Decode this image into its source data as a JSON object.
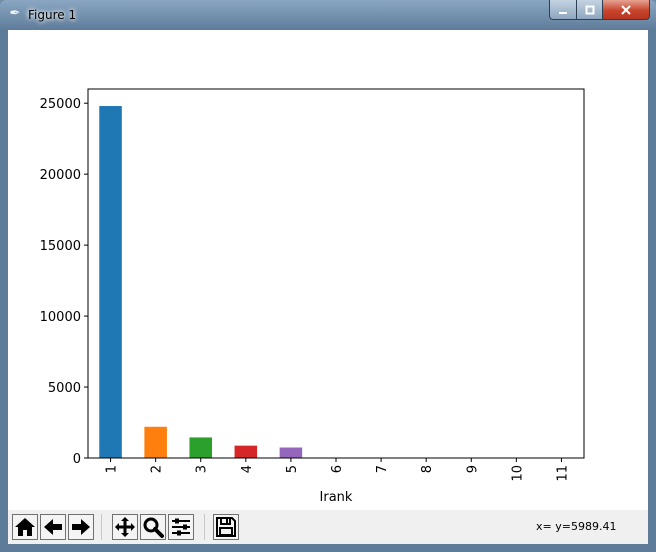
{
  "window": {
    "title": "Figure 1",
    "icon": "feather-icon",
    "buttons": [
      "minimize-icon",
      "maximize-icon",
      "close-icon"
    ]
  },
  "toolbar": {
    "buttons": [
      "home-icon",
      "back-arrow-icon",
      "forward-arrow-icon",
      "pan-icon",
      "zoom-icon",
      "subplots-icon",
      "save-icon"
    ],
    "coordinates": "x= y=5989.41"
  },
  "chart_data": {
    "type": "bar",
    "xlabel": "Irank",
    "ylabel": "",
    "categories": [
      "1",
      "2",
      "3",
      "4",
      "5",
      "6",
      "7",
      "8",
      "9",
      "10",
      "11"
    ],
    "values": [
      24800,
      2200,
      1450,
      870,
      740,
      5,
      3,
      2,
      1,
      1,
      1
    ],
    "colors": [
      "#1f77b4",
      "#ff7f0e",
      "#2ca02c",
      "#d62728",
      "#9467bd",
      "#8c564b",
      "#e377c2",
      "#7f7f7f",
      "#bcbd22",
      "#17becf",
      "#1f77b4"
    ],
    "yticks": [
      0,
      5000,
      10000,
      15000,
      20000,
      25000
    ],
    "ylim": [
      0,
      26000
    ],
    "grid": false,
    "legend": "none"
  }
}
